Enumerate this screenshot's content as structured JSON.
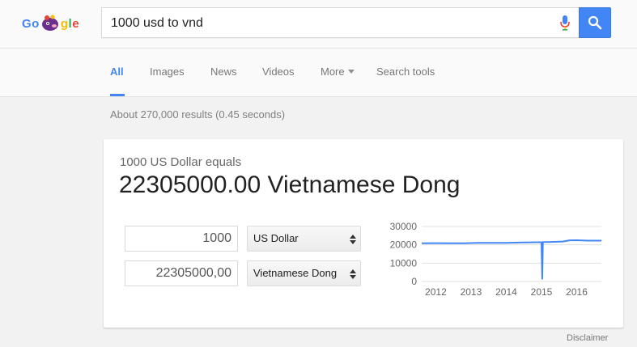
{
  "header": {
    "logo_left": "Go",
    "logo_right": "gle",
    "search_query": "1000 usd to vnd"
  },
  "tabs": [
    {
      "label": "All",
      "active": true
    },
    {
      "label": "Images"
    },
    {
      "label": "News"
    },
    {
      "label": "Videos"
    },
    {
      "label": "More"
    },
    {
      "label": "Search tools"
    }
  ],
  "result_stats": "About 270,000 results (0.45 seconds)",
  "converter": {
    "equals_label": "1000 US Dollar equals",
    "result_value": "22305000.00 Vietnamese Dong",
    "from_amount": "1000",
    "from_currency": "US Dollar",
    "to_amount": "22305000,00",
    "to_currency": "Vietnamese Dong"
  },
  "chart_data": {
    "type": "line",
    "x_ticks": [
      "2012",
      "2013",
      "2014",
      "2015",
      "2016"
    ],
    "y_ticks": [
      "30000",
      "20000",
      "10000",
      "0"
    ],
    "ylim": [
      0,
      30000
    ],
    "xlim": [
      2011.6,
      2016.7
    ],
    "grid": true,
    "series": [
      {
        "x": [
          2011.6,
          2012.0,
          2012.4,
          2012.8,
          2013.2,
          2013.5,
          2014.0,
          2014.5,
          2014.9,
          2015.0,
          2015.02,
          2015.04,
          2015.2,
          2015.5,
          2015.6,
          2015.8,
          2016.0,
          2016.3,
          2016.5,
          2016.7
        ],
        "values": [
          20850,
          20900,
          20850,
          20850,
          21050,
          21100,
          21100,
          21300,
          21400,
          21400,
          1500,
          21500,
          21500,
          21700,
          21800,
          22450,
          22500,
          22300,
          22300,
          22300
        ]
      }
    ],
    "line_color": "#4285f4"
  },
  "disclaimer": "Disclaimer",
  "colors": {
    "accent": "#4285f4",
    "logo_blue": "#4285f4",
    "logo_red": "#ea4335",
    "logo_yellow": "#fbbc05",
    "logo_green": "#34a853"
  },
  "icons": {
    "mic": "mic-icon",
    "search": "search-icon",
    "caret": "caret-down-icon",
    "select_arrows": "select-arrows-icon"
  }
}
